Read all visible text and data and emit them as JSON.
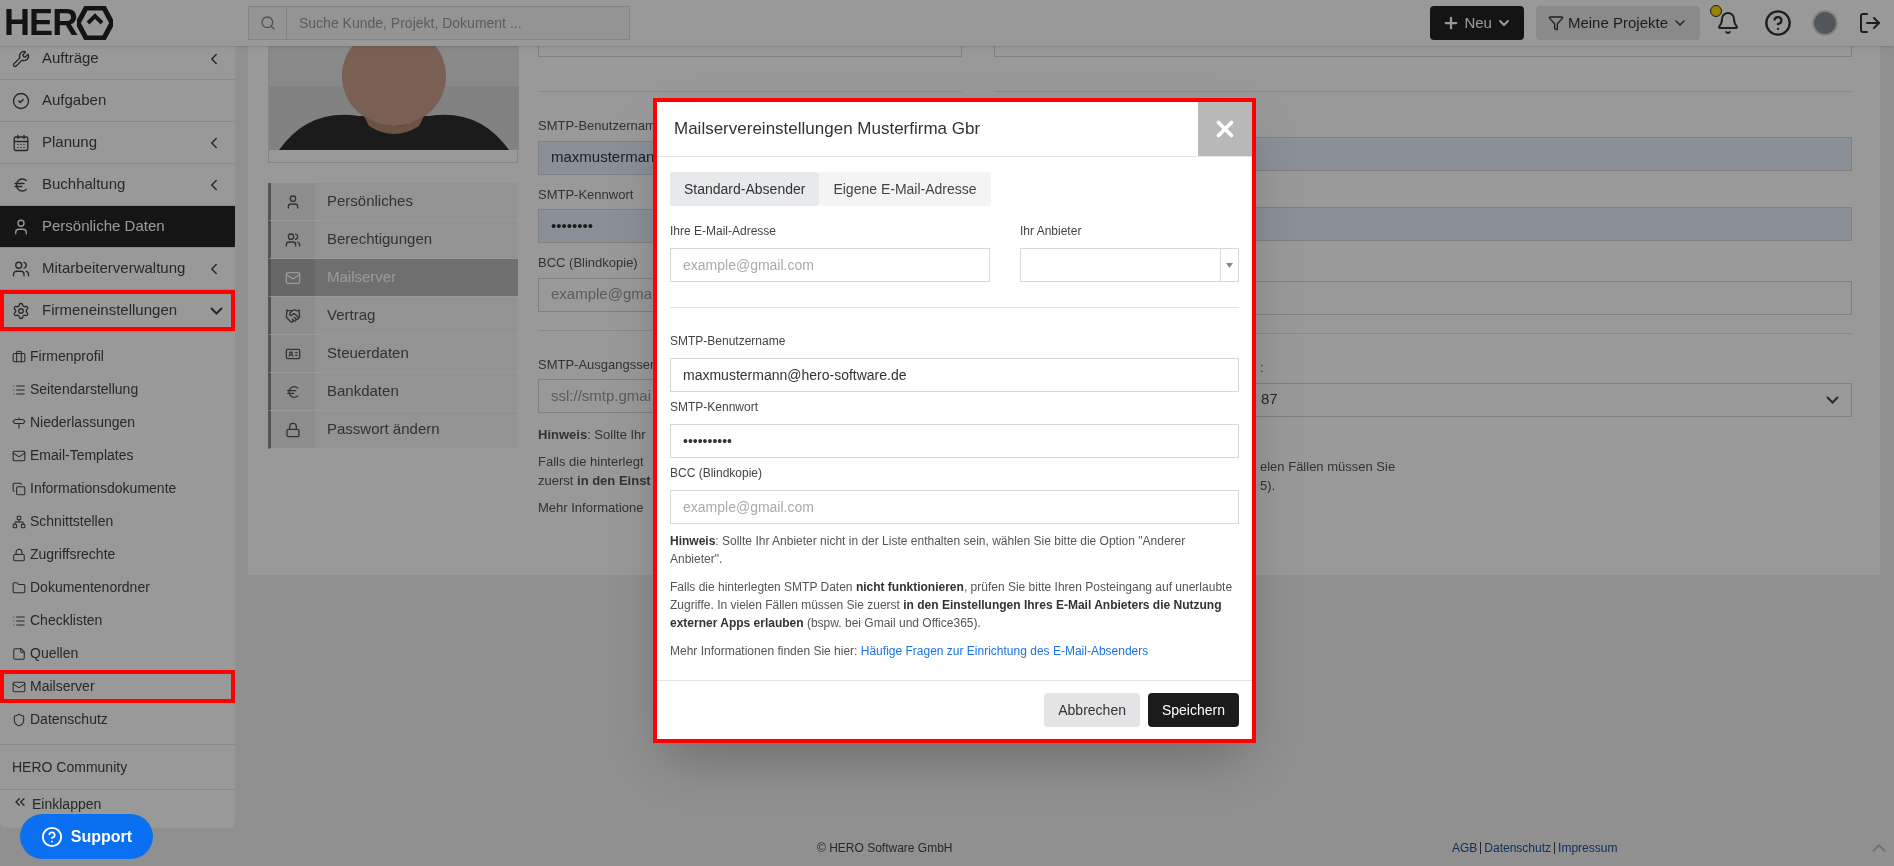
{
  "header": {
    "logo": "HER",
    "search_placeholder": "Suche Kunde, Projekt, Dokument ...",
    "new_button": "Neu",
    "projects_button": "Meine Projekte"
  },
  "sidebar": {
    "items": [
      {
        "label": "Aufträge",
        "selected": false,
        "expanded": false,
        "highlighted": false
      },
      {
        "label": "Aufgaben",
        "selected": false,
        "highlighted": false
      },
      {
        "label": "Planung",
        "selected": false,
        "expanded": false,
        "highlighted": false
      },
      {
        "label": "Buchhaltung",
        "selected": false,
        "expanded": false,
        "highlighted": false
      },
      {
        "label": "Persönliche Daten",
        "selected": true,
        "highlighted": false
      },
      {
        "label": "Mitarbeiterverwaltung",
        "selected": false,
        "expanded": false,
        "highlighted": false
      },
      {
        "label": "Firmeneinstellungen",
        "selected": false,
        "expanded": true,
        "highlighted": true,
        "children": [
          {
            "label": "Firmenprofil",
            "highlighted": false
          },
          {
            "label": "Seitendarstellung",
            "highlighted": false
          },
          {
            "label": "Niederlassungen",
            "highlighted": false
          },
          {
            "label": "Email-Templates",
            "highlighted": false
          },
          {
            "label": "Informationsdokumente",
            "highlighted": false
          },
          {
            "label": "Schnittstellen",
            "highlighted": false
          },
          {
            "label": "Zugriffsrechte",
            "highlighted": false
          },
          {
            "label": "Dokumentenordner",
            "highlighted": false
          },
          {
            "label": "Checklisten",
            "highlighted": false
          },
          {
            "label": "Quellen",
            "highlighted": false
          },
          {
            "label": "Mailserver",
            "highlighted": true
          },
          {
            "label": "Datenschutz",
            "highlighted": false
          }
        ]
      }
    ],
    "community": "HERO Community",
    "collapse": "Einklappen"
  },
  "support_button": "Support",
  "profile_nav": [
    {
      "label": "Persönliches",
      "selected": false
    },
    {
      "label": "Berechtigungen",
      "selected": false
    },
    {
      "label": "Mailserver",
      "selected": true
    },
    {
      "label": "Vertrag",
      "selected": false
    },
    {
      "label": "Steuerdaten",
      "selected": false
    },
    {
      "label": "Bankdaten",
      "selected": false
    },
    {
      "label": "Passwort ändern",
      "selected": false
    }
  ],
  "background_form": {
    "fields": [
      {
        "label": "SMTP-Benutzernam",
        "value": "maxmusterman",
        "kind": "filled"
      },
      {
        "label": "SMTP-Kennwort",
        "value": "••••••••",
        "kind": "filled"
      },
      {
        "label": "BCC (Blindkopie)",
        "placeholder": "example@gmai",
        "kind": "empty"
      }
    ],
    "server_label": "SMTP-Ausgangsser",
    "server_placeholder": "ssl://smtp.gmai",
    "port_label": ":",
    "port_value": "87",
    "notes": [
      "**Hinweis**: Sollte Ihr",
      "Falls die hinterlegt",
      "zuerst **in den Einst**",
      "Mehr Informatione"
    ],
    "right_notes": [
      "elen Fällen müssen Sie",
      "5)."
    ]
  },
  "modal": {
    "highlighted": true,
    "title": "Mailservereinstellungen Musterfirma Gbr",
    "tabs": [
      {
        "label": "Standard-Absender",
        "selected": true
      },
      {
        "label": "Eigene E-Mail-Adresse",
        "selected": false
      }
    ],
    "email_label": "Ihre E-Mail-Adresse",
    "email_placeholder": "example@gmail.com",
    "provider_label": "Ihr Anbieter",
    "fields": [
      {
        "label": "SMTP-Benutzername",
        "value": "maxmustermann@hero-software.de"
      },
      {
        "label": "SMTP-Kennwort",
        "value": "••••••••••"
      },
      {
        "label": "BCC (Blindkopie)",
        "placeholder": "example@gmail.com"
      }
    ],
    "notes": [
      "**Hinweis**: Sollte Ihr Anbieter nicht in der Liste enthalten sein, wählen Sie bitte die Option \"Anderer Anbieter\".",
      "Falls die hinterlegten SMTP Daten **nicht funktionieren**, prüfen Sie bitte Ihren Posteingang auf unerlaubte Zugriffe. In vielen Fällen müssen Sie zuerst **in den Einstellungen Ihres E-Mail Anbieters die Nutzung externer Apps erlauben** (bspw. bei Gmail und Office365)."
    ],
    "more_info": "Mehr Informationen finden Sie hier:",
    "more_info_link": "Häufige Fragen zur Einrichtung des E-Mail-Absenders",
    "cancel": "Abbrechen",
    "save": "Speichern"
  },
  "footer": {
    "copyright": "© HERO Software GmbH",
    "links": [
      "AGB",
      "Datenschutz",
      "Impressum"
    ]
  }
}
